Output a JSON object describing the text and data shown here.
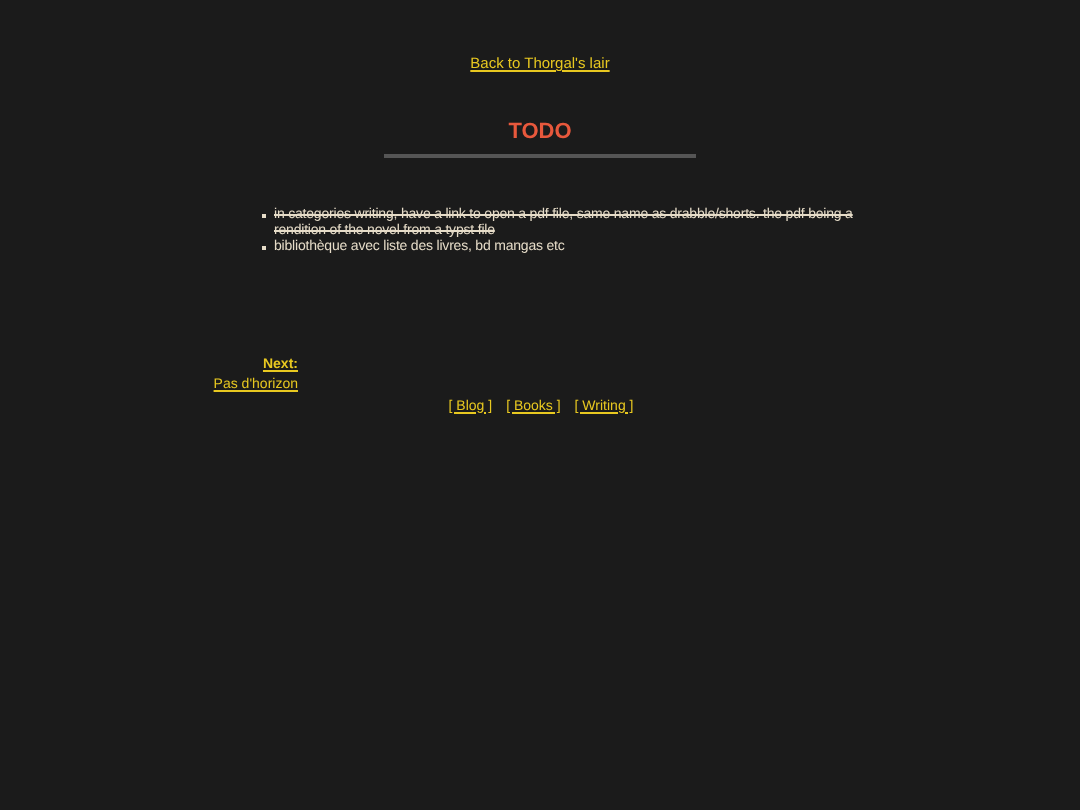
{
  "back_link": "Back to Thorgal's lair",
  "title": "TODO",
  "items": [
    {
      "text": "in categories writing, have a link to open a pdf file, same name as drabble/shorts. the pdf being a rendition of the novel from a typst file",
      "done": true
    },
    {
      "text": "bibliothèque avec liste des livres, bd mangas etc",
      "done": false
    }
  ],
  "next": {
    "label": "Next:",
    "link": "Pas d'horizon"
  },
  "footer_links": [
    "[ Blog ]",
    "[ Books ]",
    "[ Writing ]"
  ]
}
